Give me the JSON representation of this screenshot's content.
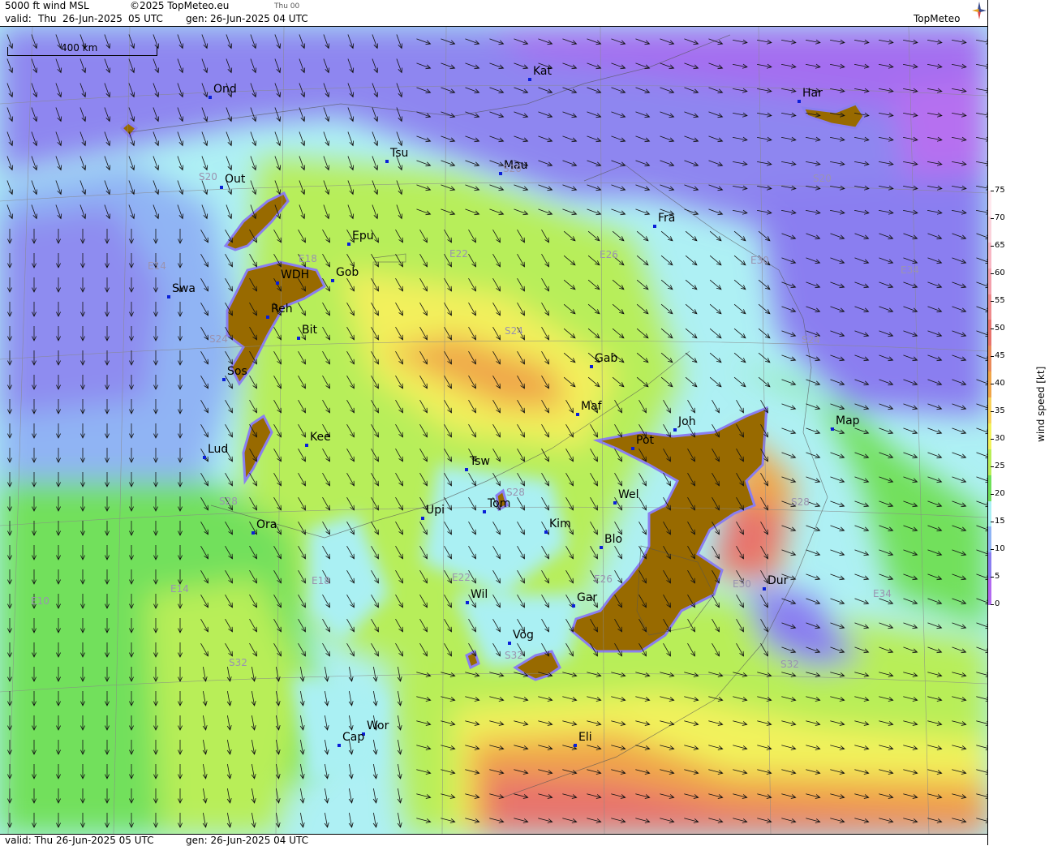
{
  "header": {
    "product": "5000 ft wind MSL",
    "copyright": "©2025 TopMeteo.eu",
    "day_short": "Thu 00",
    "valid_label": "valid:",
    "valid_day": "Thu",
    "valid_date": "26-Jun-2025",
    "valid_time": "05 UTC",
    "gen_label": "gen:",
    "gen_value": "26-Jun-2025 04 UTC",
    "brand": "TopMeteo"
  },
  "footer": {
    "valid": "valid:  Thu   26-Jun-2025  05 UTC",
    "gen": "gen: 26-Jun-2025 04 UTC"
  },
  "scale": {
    "label": "400 km"
  },
  "legend": {
    "unit": "wind speed  [kt]",
    "ticks": [
      "75",
      "70",
      "65",
      "60",
      "55",
      "50",
      "45",
      "40",
      "35",
      "30",
      "25",
      "20",
      "15",
      "10",
      "5",
      "0"
    ],
    "colors": [
      "#ffe8ee",
      "#fbd3dc",
      "#f8b7c4",
      "#f3a0ac",
      "#ee8a8c",
      "#e8736c",
      "#ea8a5a",
      "#f0a548",
      "#f8d25a",
      "#f2f25c",
      "#b8ee58",
      "#6fe05a",
      "#aaf0f3",
      "#8fb4f4",
      "#8a7ef0",
      "#b36af0"
    ]
  },
  "cities": [
    {
      "name": "Ond"
    },
    {
      "name": "Kat"
    },
    {
      "name": "Har"
    },
    {
      "name": "Tsu"
    },
    {
      "name": "Mau"
    },
    {
      "name": "Out"
    },
    {
      "name": "Fra"
    },
    {
      "name": "Epu"
    },
    {
      "name": "WDH"
    },
    {
      "name": "Gob"
    },
    {
      "name": "Swa"
    },
    {
      "name": "Reh"
    },
    {
      "name": "Bit"
    },
    {
      "name": "Gab"
    },
    {
      "name": "Sos"
    },
    {
      "name": "Maf"
    },
    {
      "name": "Joh"
    },
    {
      "name": "Map"
    },
    {
      "name": "Pot"
    },
    {
      "name": "Kee"
    },
    {
      "name": "Lud"
    },
    {
      "name": "Tsw"
    },
    {
      "name": "Wel"
    },
    {
      "name": "Upi"
    },
    {
      "name": "Tom"
    },
    {
      "name": "Ora"
    },
    {
      "name": "Kim"
    },
    {
      "name": "Blo"
    },
    {
      "name": "Dur"
    },
    {
      "name": "Wil"
    },
    {
      "name": "Gar"
    },
    {
      "name": "Vog"
    },
    {
      "name": "Wor"
    },
    {
      "name": "Cap"
    },
    {
      "name": "Eli"
    }
  ],
  "grid_labels": [
    "S20",
    "S20",
    "S20",
    "E14",
    "E18",
    "E22",
    "E26",
    "E30",
    "E34",
    "S24",
    "S24",
    "S24",
    "S28",
    "S28",
    "S28",
    "E10",
    "E14",
    "E18",
    "E22",
    "E26",
    "E30",
    "E34",
    "S32",
    "S32",
    "S32"
  ]
}
